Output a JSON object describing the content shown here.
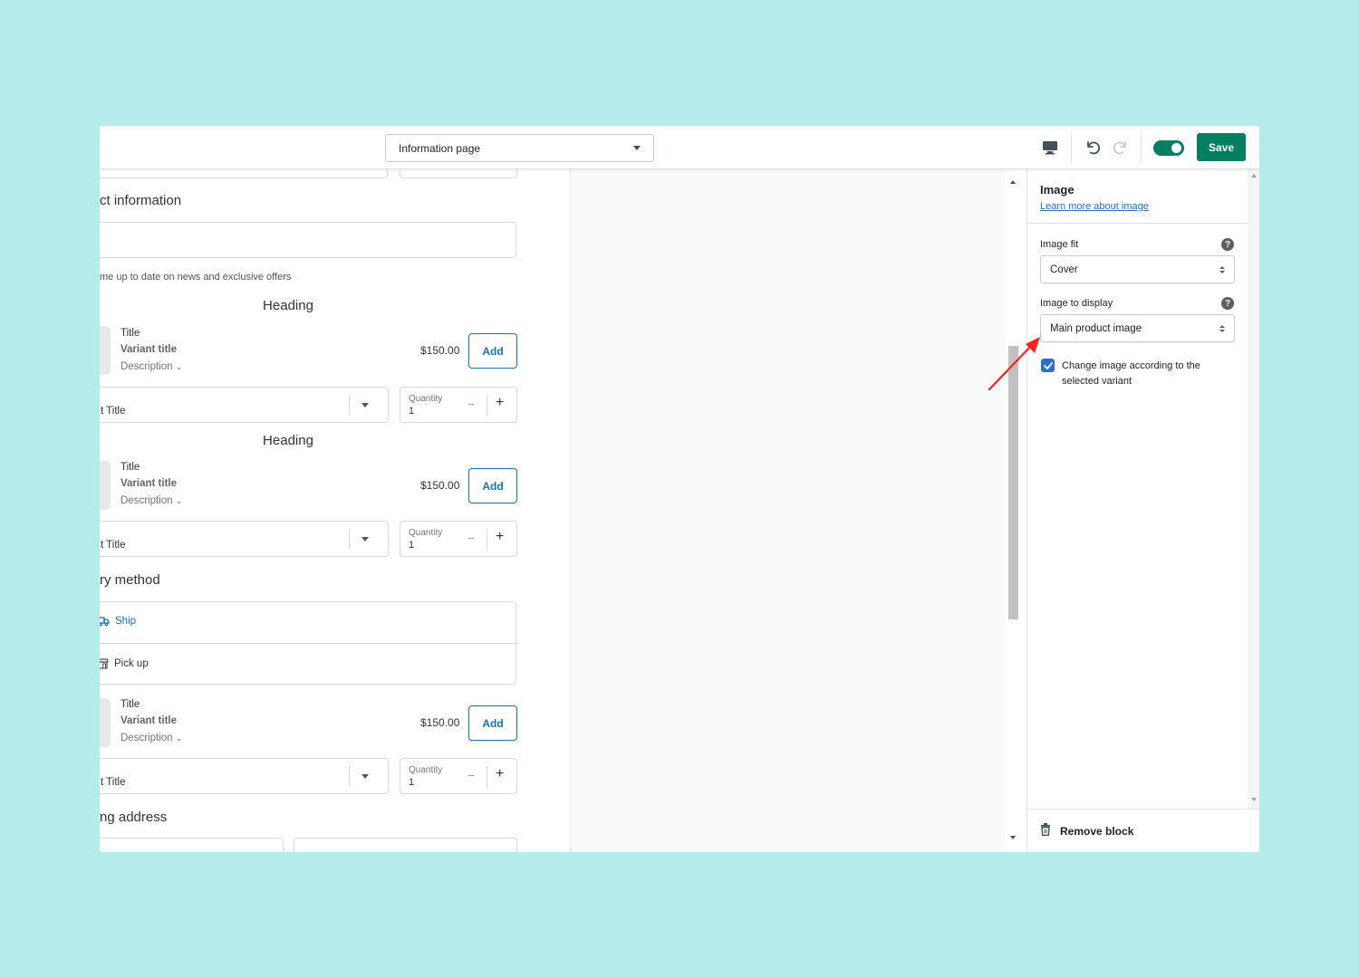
{
  "topbar": {
    "page_select": "Information page",
    "save_label": "Save"
  },
  "preview": {
    "contact_title": "ct information",
    "newsletter_text": "me up to date on news and exclusive offers",
    "heading": "Heading",
    "product": {
      "title": "Title",
      "variant": "Variant title",
      "description": "Description",
      "price": "$150.00",
      "add_label": "Add"
    },
    "select_title": "t Title",
    "quantity_label": "Quantity",
    "quantity_value": "1",
    "delivery_title": "ry method",
    "ship_label": "Ship",
    "pickup_label": "Pick up",
    "shipping_title": "ng address"
  },
  "panel": {
    "title": "Image",
    "learn_link": "Learn more about image",
    "image_fit_label": "Image fit",
    "image_fit_value": "Cover",
    "image_display_label": "Image to display",
    "image_display_value": "Main product image",
    "checkbox_label": "Change image according to the selected variant",
    "checkbox_checked": true,
    "remove_label": "Remove block"
  },
  "colors": {
    "background": "#b5ebeb",
    "accent_green": "#008060",
    "link_blue": "#2c6ecb",
    "add_blue": "#1773b0",
    "arrow_red": "#ff2020"
  }
}
